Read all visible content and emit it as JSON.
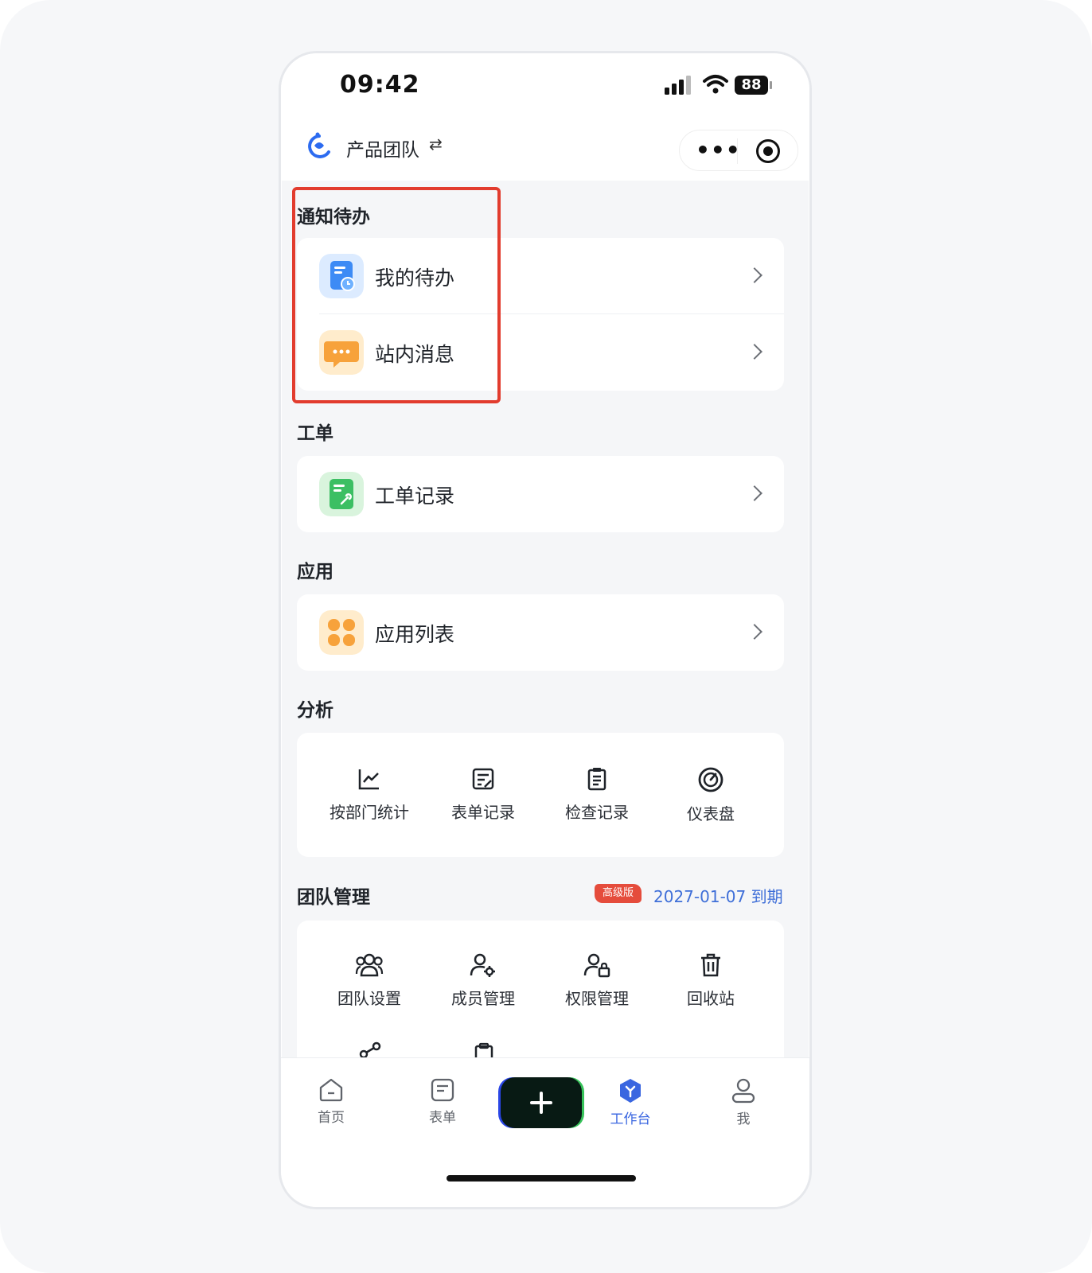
{
  "status": {
    "time": "09:42",
    "battery": "88"
  },
  "nav": {
    "team_name": "产品团队",
    "swap": "⇄"
  },
  "sections": {
    "notify": {
      "title": "通知待办",
      "items": [
        {
          "label": "我的待办"
        },
        {
          "label": "站内消息"
        }
      ]
    },
    "ticket": {
      "title": "工单",
      "items": [
        {
          "label": "工单记录"
        }
      ]
    },
    "apps": {
      "title": "应用",
      "items": [
        {
          "label": "应用列表"
        }
      ]
    },
    "analysis": {
      "title": "分析",
      "items": [
        {
          "label": "按部门统计"
        },
        {
          "label": "表单记录"
        },
        {
          "label": "检查记录"
        },
        {
          "label": "仪表盘"
        }
      ]
    },
    "team": {
      "title": "团队管理",
      "badge": "高级版",
      "expire": "2027-01-07 到期",
      "items": [
        {
          "label": "团队设置"
        },
        {
          "label": "成员管理"
        },
        {
          "label": "权限管理"
        },
        {
          "label": "回收站"
        }
      ]
    }
  },
  "tabbar": {
    "tabs": [
      {
        "label": "首页"
      },
      {
        "label": "表单"
      },
      {
        "label": "工作台",
        "active": true
      },
      {
        "label": "我"
      }
    ]
  },
  "colors": {
    "accent": "#3a66e0",
    "highlight": "#e23c2e",
    "badge": "#e54c3c"
  }
}
